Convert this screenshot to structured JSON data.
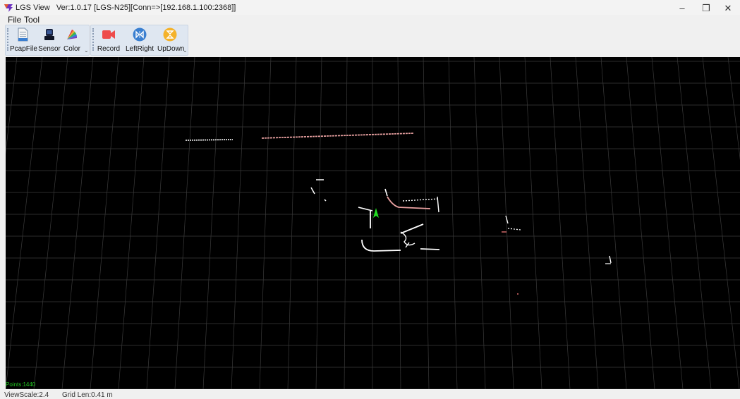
{
  "window": {
    "title_app": "LGS View",
    "title_detail": "Ver:1.0.17  [LGS-N25][Conn=>[192.168.1.100:2368]]",
    "minimize": "–",
    "restore": "❐",
    "close": "✕"
  },
  "menu": {
    "file": "File",
    "tool": "Tool"
  },
  "toolbar": {
    "pcapfile": "PcapFile",
    "sensor": "Sensor",
    "color": "Color",
    "record": "Record",
    "leftright": "LeftRight",
    "updown": "UpDown",
    "more": "⌄"
  },
  "colors": {
    "viewport_bg": "#000000",
    "grid": "#3a3a3a",
    "points": "#ffffff",
    "accent_points": "#e07070",
    "arrow": "#22dd22"
  },
  "viewport": {
    "points_label": "Points:1440"
  },
  "status": {
    "view_scale": "ViewScale:2.4",
    "grid_len": "Grid Len:0.41 m"
  }
}
